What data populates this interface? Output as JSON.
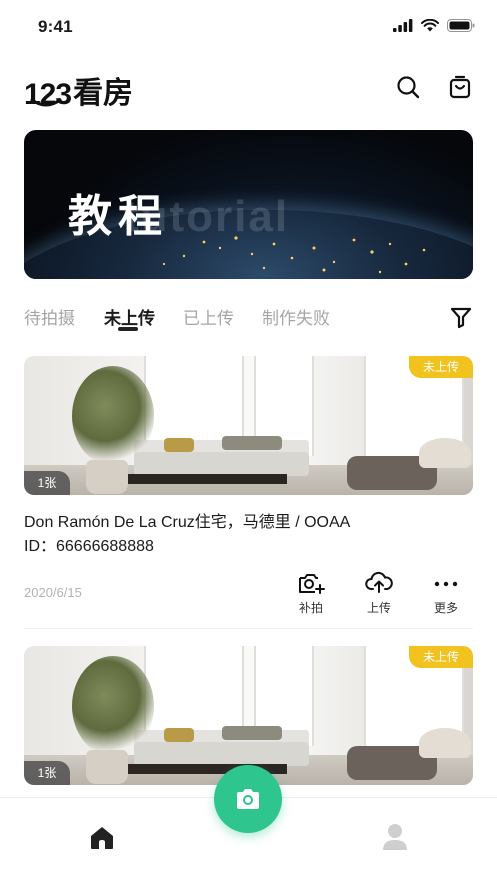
{
  "status_bar": {
    "time": "9:41"
  },
  "header": {
    "logo_number": "123",
    "logo_text": "看房"
  },
  "banner": {
    "title": "教程",
    "subtitle": "tutorial"
  },
  "tabs": [
    {
      "label": "待拍摄",
      "active": false
    },
    {
      "label": "未上传",
      "active": true
    },
    {
      "label": "已上传",
      "active": false
    },
    {
      "label": "制作失败",
      "active": false
    }
  ],
  "cards": [
    {
      "status": "未上传",
      "photo_count": "1张",
      "title": "Don Ramón De La Cruz住宅，马德里 / OOAA",
      "id_text": "ID：66666688888",
      "date": "2020/6/15",
      "actions": [
        {
          "label": "补拍",
          "icon": "camera-add-icon"
        },
        {
          "label": "上传",
          "icon": "cloud-upload-icon"
        },
        {
          "label": "更多",
          "icon": "more-icon"
        }
      ]
    },
    {
      "status": "未上传",
      "photo_count": "1张"
    }
  ],
  "tab_bar": {
    "home_icon": "home-icon",
    "camera_icon": "camera-icon",
    "profile_icon": "profile-icon"
  },
  "colors": {
    "accent": "#2fc58e",
    "badge": "#f2c31f",
    "muted": "#a6a6a6"
  }
}
